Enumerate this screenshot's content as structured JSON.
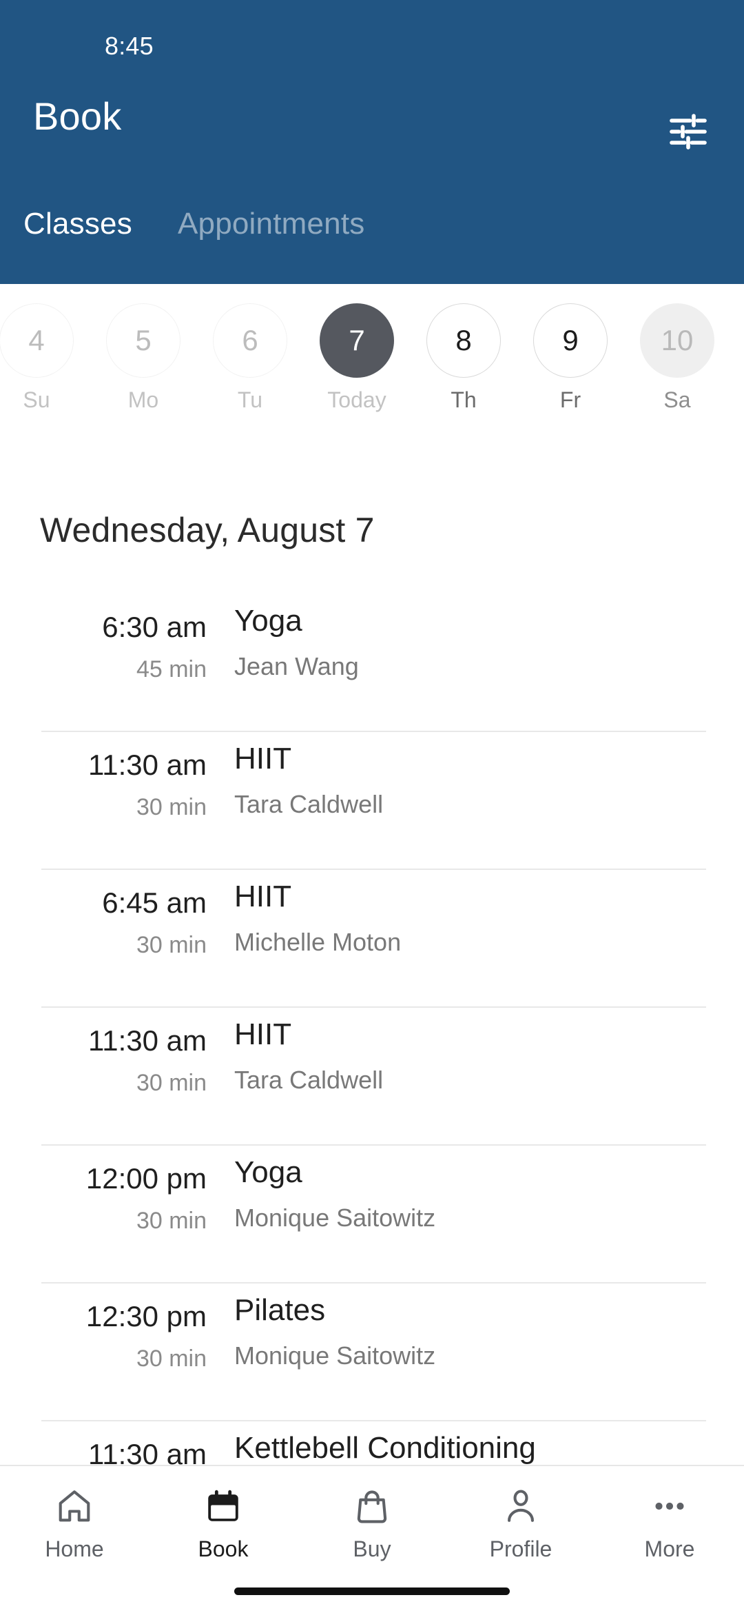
{
  "status_bar": {
    "time": "8:45"
  },
  "header": {
    "title": "Book",
    "background_color": "#215583",
    "filter_icon": "tune-icon",
    "tabs": [
      {
        "label": "Classes",
        "active": true
      },
      {
        "label": "Appointments",
        "active": false
      }
    ]
  },
  "date_strip": {
    "days": [
      {
        "date": "4",
        "weekday": "Su",
        "state": "past"
      },
      {
        "date": "5",
        "weekday": "Mo",
        "state": "past"
      },
      {
        "date": "6",
        "weekday": "Tu",
        "state": "past"
      },
      {
        "date": "7",
        "weekday": "Today",
        "state": "today"
      },
      {
        "date": "8",
        "weekday": "Th",
        "state": "future"
      },
      {
        "date": "9",
        "weekday": "Fr",
        "state": "future"
      },
      {
        "date": "10",
        "weekday": "Sa",
        "state": "pressed"
      }
    ],
    "selected_color": "#55585f"
  },
  "schedule": {
    "date_heading": "Wednesday, August 7",
    "classes": [
      {
        "time": "6:30 am",
        "duration": "45 min",
        "name": "Yoga",
        "instructor": "Jean Wang"
      },
      {
        "time": "11:30 am",
        "duration": "30 min",
        "name": "HIIT",
        "instructor": "Tara Caldwell"
      },
      {
        "time": "6:45 am",
        "duration": "30 min",
        "name": "HIIT",
        "instructor": "Michelle Moton"
      },
      {
        "time": "11:30 am",
        "duration": "30 min",
        "name": "HIIT",
        "instructor": "Tara Caldwell"
      },
      {
        "time": "12:00 pm",
        "duration": "30 min",
        "name": "Yoga",
        "instructor": "Monique Saitowitz"
      },
      {
        "time": "12:30 pm",
        "duration": "30 min",
        "name": "Pilates",
        "instructor": "Monique Saitowitz"
      },
      {
        "time": "11:30 am",
        "duration": "",
        "name": "Kettlebell Conditioning",
        "instructor": ""
      }
    ]
  },
  "bottom_nav": {
    "items": [
      {
        "label": "Home",
        "icon": "home-icon",
        "active": false
      },
      {
        "label": "Book",
        "icon": "calendar-icon",
        "active": true
      },
      {
        "label": "Buy",
        "icon": "shopping-bag-icon",
        "active": false
      },
      {
        "label": "Profile",
        "icon": "person-icon",
        "active": false
      },
      {
        "label": "More",
        "icon": "more-dots-icon",
        "active": false
      }
    ]
  }
}
